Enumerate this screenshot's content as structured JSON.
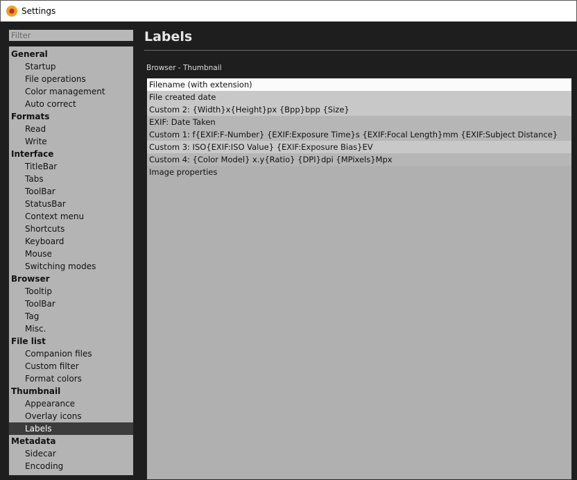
{
  "window": {
    "title": "Settings"
  },
  "sidebar": {
    "filter_placeholder": "Filter",
    "items": [
      {
        "label": "General",
        "type": "cat"
      },
      {
        "label": "Startup",
        "type": "sub"
      },
      {
        "label": "File operations",
        "type": "sub"
      },
      {
        "label": "Color management",
        "type": "sub"
      },
      {
        "label": "Auto correct",
        "type": "sub"
      },
      {
        "label": "Formats",
        "type": "cat"
      },
      {
        "label": "Read",
        "type": "sub"
      },
      {
        "label": "Write",
        "type": "sub"
      },
      {
        "label": "Interface",
        "type": "cat"
      },
      {
        "label": "TitleBar",
        "type": "sub"
      },
      {
        "label": "Tabs",
        "type": "sub"
      },
      {
        "label": "ToolBar",
        "type": "sub"
      },
      {
        "label": "StatusBar",
        "type": "sub"
      },
      {
        "label": "Context menu",
        "type": "sub"
      },
      {
        "label": "Shortcuts",
        "type": "sub"
      },
      {
        "label": "Keyboard",
        "type": "sub"
      },
      {
        "label": "Mouse",
        "type": "sub"
      },
      {
        "label": "Switching modes",
        "type": "sub"
      },
      {
        "label": "Browser",
        "type": "cat"
      },
      {
        "label": "Tooltip",
        "type": "sub"
      },
      {
        "label": "ToolBar",
        "type": "sub"
      },
      {
        "label": "Tag",
        "type": "sub"
      },
      {
        "label": "Misc.",
        "type": "sub"
      },
      {
        "label": "File list",
        "type": "cat"
      },
      {
        "label": "Companion files",
        "type": "sub"
      },
      {
        "label": "Custom filter",
        "type": "sub"
      },
      {
        "label": "Format colors",
        "type": "sub"
      },
      {
        "label": "Thumbnail",
        "type": "cat"
      },
      {
        "label": "Appearance",
        "type": "sub"
      },
      {
        "label": "Overlay icons",
        "type": "sub"
      },
      {
        "label": "Labels",
        "type": "sub",
        "selected": true
      },
      {
        "label": "Metadata",
        "type": "cat"
      },
      {
        "label": "Sidecar",
        "type": "sub"
      },
      {
        "label": "Encoding",
        "type": "sub"
      }
    ]
  },
  "main": {
    "title": "Labels",
    "section": "Browser - Thumbnail",
    "labels": [
      {
        "text": "Filename (with extension)",
        "shade": 0
      },
      {
        "text": "File created date",
        "shade": 1
      },
      {
        "text": "Custom 2: {Width}x{Height}px {Bpp}bpp {Size}",
        "shade": 1
      },
      {
        "text": "EXIF: Date Taken",
        "shade": 2
      },
      {
        "text": "Custom 1: f{EXIF:F-Number} {EXIF:Exposure Time}s {EXIF:Focal Length}mm {EXIF:Subject Distance}",
        "shade": 2
      },
      {
        "text": "Custom 3: ISO{EXIF:ISO Value} {EXIF:Exposure Bias}EV",
        "shade": 1
      },
      {
        "text": "Custom 4: {Color Model} x.y{Ratio} {DPI}dpi {MPixels}Mpx",
        "shade": 2
      },
      {
        "text": "Image properties",
        "shade": 3
      }
    ]
  }
}
